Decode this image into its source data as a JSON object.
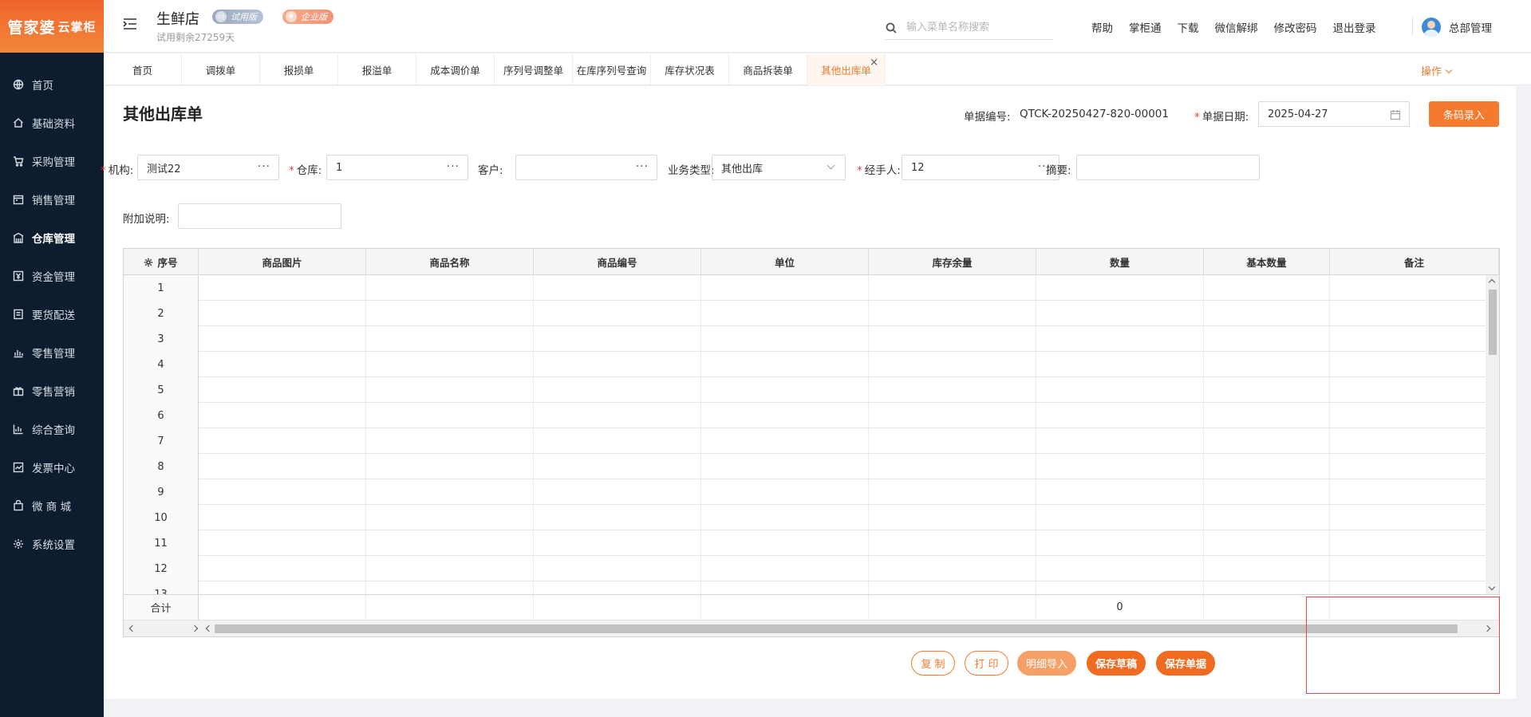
{
  "brand": {
    "logo_text": "管家婆",
    "logo_sub": "云掌柜"
  },
  "sidebar": {
    "items": [
      {
        "label": "首页",
        "icon": "globe-icon",
        "active": false
      },
      {
        "label": "基础资料",
        "icon": "home-icon",
        "active": false
      },
      {
        "label": "采购管理",
        "icon": "cart-icon",
        "active": false
      },
      {
        "label": "销售管理",
        "icon": "calendar-icon",
        "active": false
      },
      {
        "label": "仓库管理",
        "icon": "warehouse-icon",
        "active": true
      },
      {
        "label": "资金管理",
        "icon": "money-icon",
        "active": false
      },
      {
        "label": "要货配送",
        "icon": "clipboard-icon",
        "active": false
      },
      {
        "label": "零售管理",
        "icon": "bar-chart-icon",
        "active": false
      },
      {
        "label": "零售营销",
        "icon": "gift-icon",
        "active": false
      },
      {
        "label": "综合查询",
        "icon": "stats-icon",
        "active": false
      },
      {
        "label": "发票中心",
        "icon": "invoice-icon",
        "active": false
      },
      {
        "label": "微 商 城",
        "icon": "bag-icon",
        "active": false
      },
      {
        "label": "系统设置",
        "icon": "gear-icon",
        "active": false
      }
    ]
  },
  "header": {
    "store_name": "生鲜店",
    "badge_trial": "试用版",
    "badge_enterprise": "企业版",
    "trial_days": "试用剩余27259天",
    "search_placeholder": "输入菜单名称搜索",
    "links": [
      "帮助",
      "掌柜通",
      "下载",
      "微信解绑",
      "修改密码",
      "退出登录"
    ],
    "user_name": "总部管理"
  },
  "tabs": {
    "items": [
      "首页",
      "调拨单",
      "报损单",
      "报溢单",
      "成本调价单",
      "序列号调整单",
      "在库序列号查询",
      "库存状况表",
      "商品拆装单",
      "其他出库单"
    ],
    "active_index": 9,
    "operations_label": "操作"
  },
  "form": {
    "title": "其他出库单",
    "doc_no_label": "单据编号:",
    "doc_no_value": "QTCK-20250427-820-00001",
    "date_label": "单据日期:",
    "date_value": "2025-04-27",
    "barcode_button": "条码录入",
    "org_label": "机构:",
    "org_value": "测试22",
    "warehouse_label": "仓库:",
    "warehouse_value": "1",
    "customer_label": "客户:",
    "customer_value": "",
    "biz_type_label": "业务类型:",
    "biz_type_value": "其他出库",
    "handler_label": "经手人:",
    "handler_value": "12",
    "summary_label": "摘要:",
    "summary_value": "",
    "extra_label": "附加说明:",
    "extra_value": ""
  },
  "table": {
    "columns": [
      "序号",
      "商品图片",
      "商品名称",
      "商品编号",
      "单位",
      "库存余量",
      "数量",
      "基本数量",
      "备注"
    ],
    "rows": [
      "1",
      "2",
      "3",
      "4",
      "5",
      "6",
      "7",
      "8",
      "9",
      "10",
      "11",
      "12",
      "13"
    ],
    "total_label": "合计",
    "total_quantity": "0"
  },
  "actions": {
    "copy": "复 制",
    "print": "打 印",
    "import_detail": "明细导入",
    "save_draft": "保存草稿",
    "save_doc": "保存单据"
  },
  "colors": {
    "accent": "#f47a2e",
    "sidebar_bg": "#0e1c2f",
    "required": "#e63a3a"
  }
}
